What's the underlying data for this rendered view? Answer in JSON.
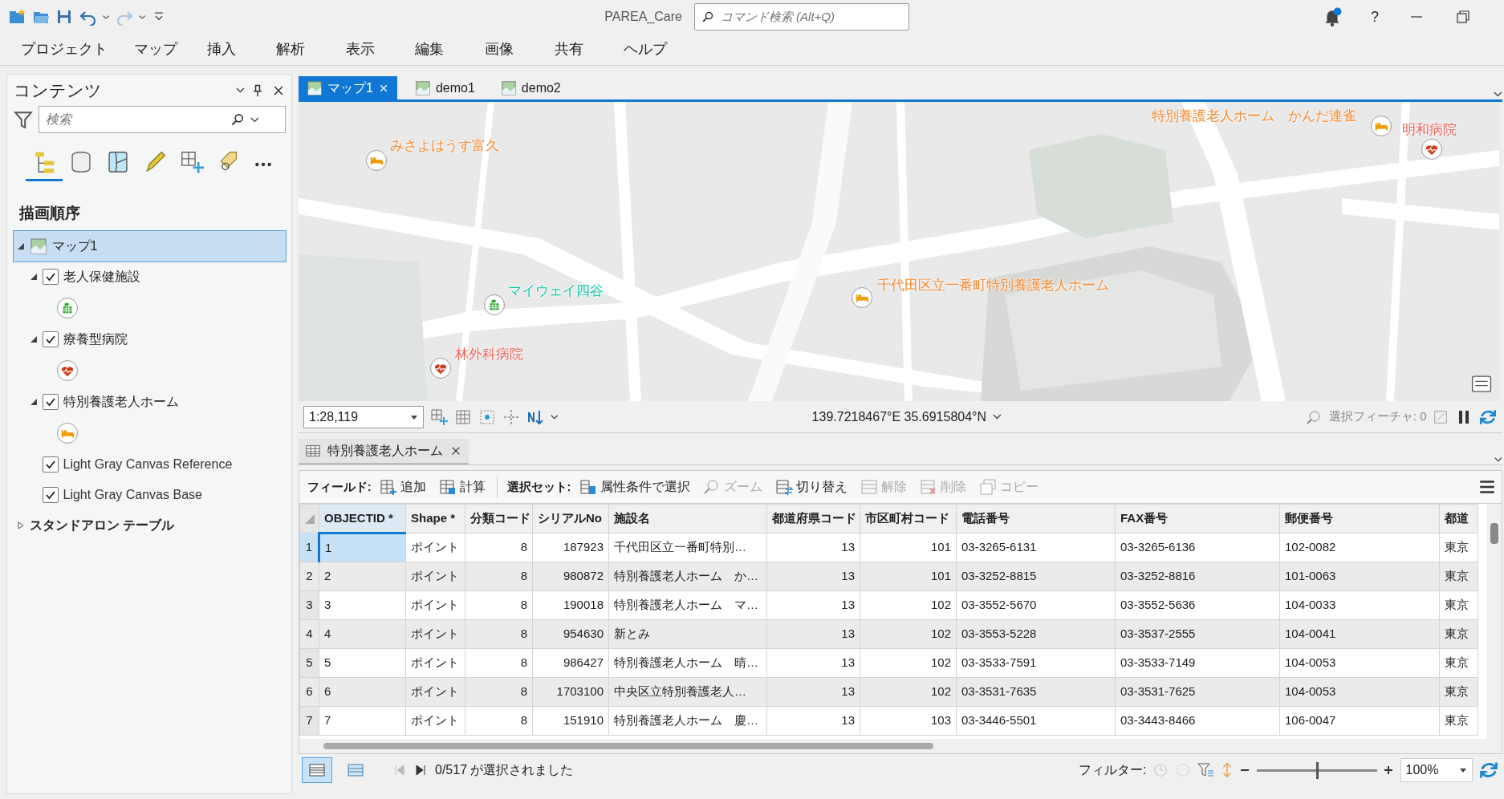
{
  "window": {
    "title": "PAREA_Care",
    "search_placeholder": "コマンド検索 (Alt+Q)",
    "help": "?"
  },
  "menu": [
    {
      "label": "プロジェクト"
    },
    {
      "label": "マップ"
    },
    {
      "label": "挿入"
    },
    {
      "label": "解析"
    },
    {
      "label": "表示"
    },
    {
      "label": "編集"
    },
    {
      "label": "画像"
    },
    {
      "label": "共有"
    },
    {
      "label": "ヘルプ"
    }
  ],
  "contents": {
    "title": "コンテンツ",
    "search_placeholder": "検索",
    "tool_tabs": [
      {
        "selected": true
      },
      {
        "selected": false
      },
      {
        "selected": false
      },
      {
        "selected": false
      },
      {
        "selected": false
      },
      {
        "selected": false
      }
    ],
    "heading": "描画順序",
    "tree": [
      {
        "label": "マップ1",
        "kind": "map",
        "selected": true,
        "expanded": true,
        "children": [
          {
            "label": "老人保健施設",
            "kind": "facility",
            "checked": true,
            "expanded": true
          },
          {
            "label": "療養型病院",
            "kind": "hospital",
            "checked": true,
            "expanded": true
          },
          {
            "label": "特別養護老人ホーム",
            "kind": "care_home",
            "checked": true,
            "expanded": true
          },
          {
            "label": "Light Gray Canvas Reference",
            "kind": "basemap",
            "checked": true
          },
          {
            "label": "Light Gray Canvas Base",
            "kind": "basemap",
            "checked": true
          }
        ]
      },
      {
        "label": "スタンドアロン テーブル",
        "kind": "group",
        "selected": false,
        "expanded": false
      }
    ]
  },
  "map_tabs": [
    {
      "label": "マップ1",
      "selected": true
    },
    {
      "label": "demo1",
      "selected": false
    },
    {
      "label": "demo2",
      "selected": false
    }
  ],
  "map": {
    "features": [
      {
        "label": "みさよはうす富久",
        "kind": "care_home"
      },
      {
        "label": "マイウェイ四谷",
        "kind": "facility"
      },
      {
        "label": "林外科病院",
        "kind": "hospital"
      },
      {
        "label": "千代田区立一番町特別養護老人ホーム",
        "kind": "care_home"
      },
      {
        "label": "特別養護老人ホーム　かんだ連雀",
        "kind": "care_home"
      },
      {
        "label": "明和病院",
        "kind": "hospital"
      }
    ],
    "scale": "1:28,119",
    "coordinates": "139.7218467°E 35.6915804°N",
    "selected_features": "選択フィーチャ: 0"
  },
  "table": {
    "tab": {
      "label": "特別養護老人ホーム"
    },
    "toolbar": [
      {
        "label": "フィールド:",
        "buttons": [
          {
            "label": "追加",
            "disabled": false
          },
          {
            "label": "計算",
            "disabled": false
          }
        ]
      },
      {
        "label": "選択セット:",
        "buttons": [
          {
            "label": "属性条件で選択",
            "disabled": false
          },
          {
            "label": "ズーム",
            "disabled": true
          },
          {
            "label": "切り替え",
            "disabled": false
          },
          {
            "label": "解除",
            "disabled": true
          },
          {
            "label": "削除",
            "disabled": true
          },
          {
            "label": "コピー",
            "disabled": true
          }
        ]
      }
    ],
    "columns": [
      {
        "label": "OBJECTID *",
        "kind": "text",
        "sorted": true
      },
      {
        "label": "Shape *",
        "kind": "text",
        "sorted": false
      },
      {
        "label": "分類コード",
        "kind": "number",
        "sorted": false
      },
      {
        "label": "シリアルNo",
        "kind": "number",
        "sorted": false
      },
      {
        "label": "施設名",
        "kind": "text",
        "sorted": false
      },
      {
        "label": "都道府県コード",
        "kind": "number",
        "sorted": false
      },
      {
        "label": "市区町村コード",
        "kind": "number",
        "sorted": false
      },
      {
        "label": "電話番号",
        "kind": "text",
        "sorted": false
      },
      {
        "label": "FAX番号",
        "kind": "text",
        "sorted": false
      },
      {
        "label": "郵便番号",
        "kind": "text",
        "sorted": false
      },
      {
        "label": "都道",
        "kind": "text",
        "sorted": false
      }
    ],
    "rows": [
      {
        "number": "1",
        "selected": true,
        "cells": [
          "1",
          "ポイント",
          "8",
          "187923",
          "千代田区立一番町特別…",
          "13",
          "101",
          "03-3265-6131",
          "03-3265-6136",
          "102-0082",
          "東京"
        ]
      },
      {
        "number": "2",
        "selected": false,
        "cells": [
          "2",
          "ポイント",
          "8",
          "980872",
          "特別養護老人ホーム　か…",
          "13",
          "101",
          "03-3252-8815",
          "03-3252-8816",
          "101-0063",
          "東京"
        ]
      },
      {
        "number": "3",
        "selected": false,
        "cells": [
          "3",
          "ポイント",
          "8",
          "190018",
          "特別養護老人ホーム　マ…",
          "13",
          "102",
          "03-3552-5670",
          "03-3552-5636",
          "104-0033",
          "東京"
        ]
      },
      {
        "number": "4",
        "selected": false,
        "cells": [
          "4",
          "ポイント",
          "8",
          "954630",
          "新とみ",
          "13",
          "102",
          "03-3553-5228",
          "03-3537-2555",
          "104-0041",
          "東京"
        ]
      },
      {
        "number": "5",
        "selected": false,
        "cells": [
          "5",
          "ポイント",
          "8",
          "986427",
          "特別養護老人ホーム　晴…",
          "13",
          "102",
          "03-3533-7591",
          "03-3533-7149",
          "104-0053",
          "東京"
        ]
      },
      {
        "number": "6",
        "selected": false,
        "cells": [
          "6",
          "ポイント",
          "8",
          "1703100",
          "中央区立特別養護老人…",
          "13",
          "102",
          "03-3531-7635",
          "03-3531-7625",
          "104-0053",
          "東京"
        ]
      },
      {
        "number": "7",
        "selected": false,
        "cells": [
          "7",
          "ポイント",
          "8",
          "151910",
          "特別養護老人ホーム　慶…",
          "13",
          "103",
          "03-3446-5501",
          "03-3443-8466",
          "106-0047",
          "東京"
        ]
      }
    ],
    "footer": {
      "views": [
        {
          "selected": true
        },
        {
          "selected": false
        }
      ],
      "selection_text": "0/517 が選択されました",
      "filter_label": "フィルター:",
      "zoom": {
        "level": 0.5,
        "value": "100%"
      }
    }
  }
}
